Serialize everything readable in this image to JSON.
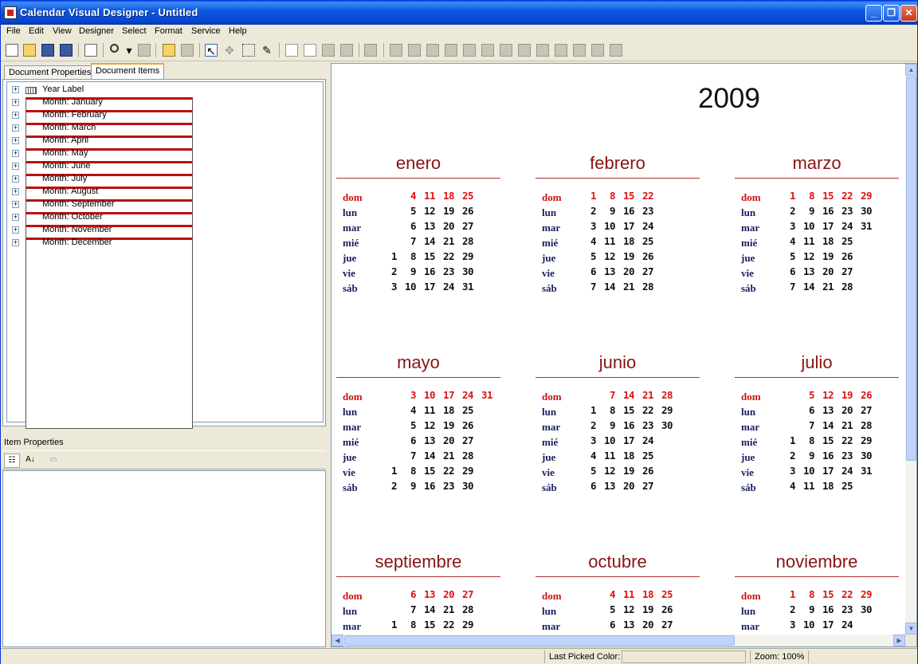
{
  "window": {
    "title": "Calendar Visual Designer - Untitled"
  },
  "menu": [
    "File",
    "Edit",
    "View",
    "Designer",
    "Select",
    "Format",
    "Service",
    "Help"
  ],
  "tabs": {
    "properties": "Document Properties",
    "items": "Document Items"
  },
  "tree": [
    {
      "label": "Year Label",
      "icon": "year-label-icon"
    },
    {
      "label": "Month: January",
      "icon": "month-icon"
    },
    {
      "label": "Month: February",
      "icon": "month-icon"
    },
    {
      "label": "Month: March",
      "icon": "month-icon"
    },
    {
      "label": "Month: April",
      "icon": "month-icon"
    },
    {
      "label": "Month: May",
      "icon": "month-icon"
    },
    {
      "label": "Month: June",
      "icon": "month-icon"
    },
    {
      "label": "Month: July",
      "icon": "month-icon"
    },
    {
      "label": "Month: August",
      "icon": "month-icon"
    },
    {
      "label": "Month: September",
      "icon": "month-icon"
    },
    {
      "label": "Month: October",
      "icon": "month-icon"
    },
    {
      "label": "Month: November",
      "icon": "month-icon"
    },
    {
      "label": "Month: December",
      "icon": "month-icon"
    }
  ],
  "item_properties": {
    "header": "Item Properties"
  },
  "calendar": {
    "year": "2009",
    "weekdays": [
      "dom",
      "lun",
      "mar",
      "mié",
      "jue",
      "vie",
      "sáb"
    ],
    "colors": {
      "month_name": "#8a1414",
      "sunday": "#dd1111",
      "weekday": "#1a2160"
    },
    "months": [
      {
        "name": "enero",
        "rows": [
          [
            "",
            "4",
            "11",
            "18",
            "25"
          ],
          [
            "",
            "5",
            "12",
            "19",
            "26"
          ],
          [
            "",
            "6",
            "13",
            "20",
            "27"
          ],
          [
            "",
            "7",
            "14",
            "21",
            "28"
          ],
          [
            "1",
            "8",
            "15",
            "22",
            "29"
          ],
          [
            "2",
            "9",
            "16",
            "23",
            "30"
          ],
          [
            "3",
            "10",
            "17",
            "24",
            "31"
          ]
        ]
      },
      {
        "name": "febrero",
        "rows": [
          [
            "1",
            "8",
            "15",
            "22",
            ""
          ],
          [
            "2",
            "9",
            "16",
            "23",
            ""
          ],
          [
            "3",
            "10",
            "17",
            "24",
            ""
          ],
          [
            "4",
            "11",
            "18",
            "25",
            ""
          ],
          [
            "5",
            "12",
            "19",
            "26",
            ""
          ],
          [
            "6",
            "13",
            "20",
            "27",
            ""
          ],
          [
            "7",
            "14",
            "21",
            "28",
            ""
          ]
        ]
      },
      {
        "name": "marzo",
        "rows": [
          [
            "1",
            "8",
            "15",
            "22",
            "29"
          ],
          [
            "2",
            "9",
            "16",
            "23",
            "30"
          ],
          [
            "3",
            "10",
            "17",
            "24",
            "31"
          ],
          [
            "4",
            "11",
            "18",
            "25",
            ""
          ],
          [
            "5",
            "12",
            "19",
            "26",
            ""
          ],
          [
            "6",
            "13",
            "20",
            "27",
            ""
          ],
          [
            "7",
            "14",
            "21",
            "28",
            ""
          ]
        ]
      },
      {
        "name": "mayo",
        "rows": [
          [
            "",
            "3",
            "10",
            "17",
            "24",
            "31"
          ],
          [
            "",
            "4",
            "11",
            "18",
            "25",
            ""
          ],
          [
            "",
            "5",
            "12",
            "19",
            "26",
            ""
          ],
          [
            "",
            "6",
            "13",
            "20",
            "27",
            ""
          ],
          [
            "",
            "7",
            "14",
            "21",
            "28",
            ""
          ],
          [
            "1",
            "8",
            "15",
            "22",
            "29",
            ""
          ],
          [
            "2",
            "9",
            "16",
            "23",
            "30",
            ""
          ]
        ]
      },
      {
        "name": "junio",
        "rows": [
          [
            "",
            "7",
            "14",
            "21",
            "28"
          ],
          [
            "1",
            "8",
            "15",
            "22",
            "29"
          ],
          [
            "2",
            "9",
            "16",
            "23",
            "30"
          ],
          [
            "3",
            "10",
            "17",
            "24",
            ""
          ],
          [
            "4",
            "11",
            "18",
            "25",
            ""
          ],
          [
            "5",
            "12",
            "19",
            "26",
            ""
          ],
          [
            "6",
            "13",
            "20",
            "27",
            ""
          ]
        ]
      },
      {
        "name": "julio",
        "rows": [
          [
            "",
            "5",
            "12",
            "19",
            "26"
          ],
          [
            "",
            "6",
            "13",
            "20",
            "27"
          ],
          [
            "",
            "7",
            "14",
            "21",
            "28"
          ],
          [
            "1",
            "8",
            "15",
            "22",
            "29"
          ],
          [
            "2",
            "9",
            "16",
            "23",
            "30"
          ],
          [
            "3",
            "10",
            "17",
            "24",
            "31"
          ],
          [
            "4",
            "11",
            "18",
            "25",
            ""
          ]
        ]
      },
      {
        "name": "septiembre",
        "rows": [
          [
            "",
            "6",
            "13",
            "20",
            "27"
          ],
          [
            "",
            "7",
            "14",
            "21",
            "28"
          ],
          [
            "1",
            "8",
            "15",
            "22",
            "29"
          ]
        ]
      },
      {
        "name": "octubre",
        "rows": [
          [
            "",
            "4",
            "11",
            "18",
            "25"
          ],
          [
            "",
            "5",
            "12",
            "19",
            "26"
          ],
          [
            "",
            "6",
            "13",
            "20",
            "27"
          ]
        ]
      },
      {
        "name": "noviembre",
        "rows": [
          [
            "1",
            "8",
            "15",
            "22",
            "29"
          ],
          [
            "2",
            "9",
            "16",
            "23",
            "30"
          ],
          [
            "3",
            "10",
            "17",
            "24",
            ""
          ]
        ]
      }
    ]
  },
  "status": {
    "last_picked_label": "Last Picked Color:",
    "zoom": "Zoom: 100%"
  }
}
